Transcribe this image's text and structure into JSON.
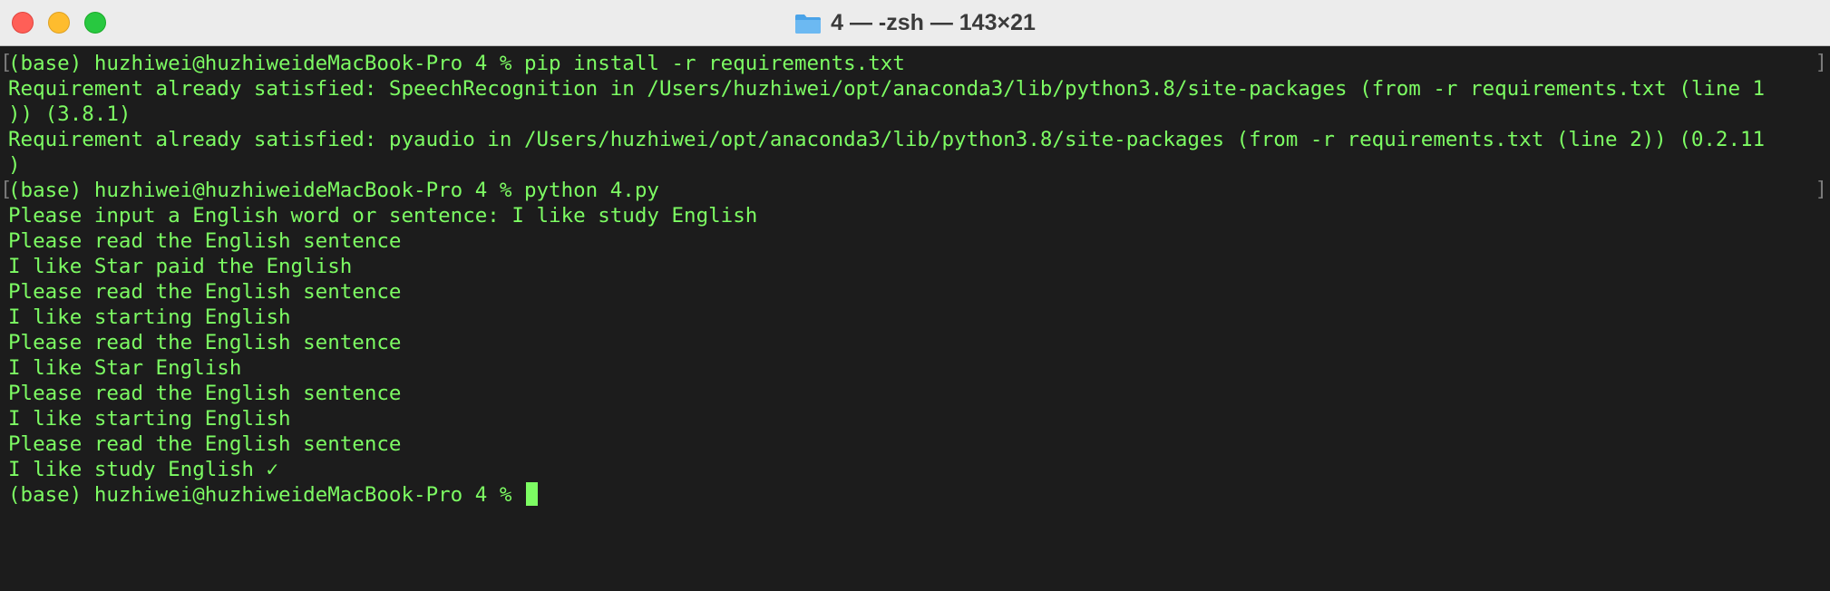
{
  "window": {
    "title": "4 — -zsh — 143×21",
    "folder_icon": "folder-icon",
    "accent_green": "#7dfc63"
  },
  "terminal": {
    "lines": [
      "(base) huzhiwei@huzhiweideMacBook-Pro 4 % pip install -r requirements.txt",
      "Requirement already satisfied: SpeechRecognition in /Users/huzhiwei/opt/anaconda3/lib/python3.8/site-packages (from -r requirements.txt (line 1",
      ")) (3.8.1)",
      "Requirement already satisfied: pyaudio in /Users/huzhiwei/opt/anaconda3/lib/python3.8/site-packages (from -r requirements.txt (line 2)) (0.2.11",
      ")",
      "(base) huzhiwei@huzhiweideMacBook-Pro 4 % python 4.py",
      "Please input a English word or sentence: I like study English",
      "Please read the English sentence",
      "I like Star paid the English",
      "Please read the English sentence",
      "I like starting English",
      "Please read the English sentence",
      "I like Star English",
      "Please read the English sentence",
      "I like starting English",
      "Please read the English sentence",
      "I like study English ✓",
      "(base) huzhiwei@huzhiweideMacBook-Pro 4 % "
    ],
    "bracket_open": "[",
    "bracket_close": "]"
  }
}
